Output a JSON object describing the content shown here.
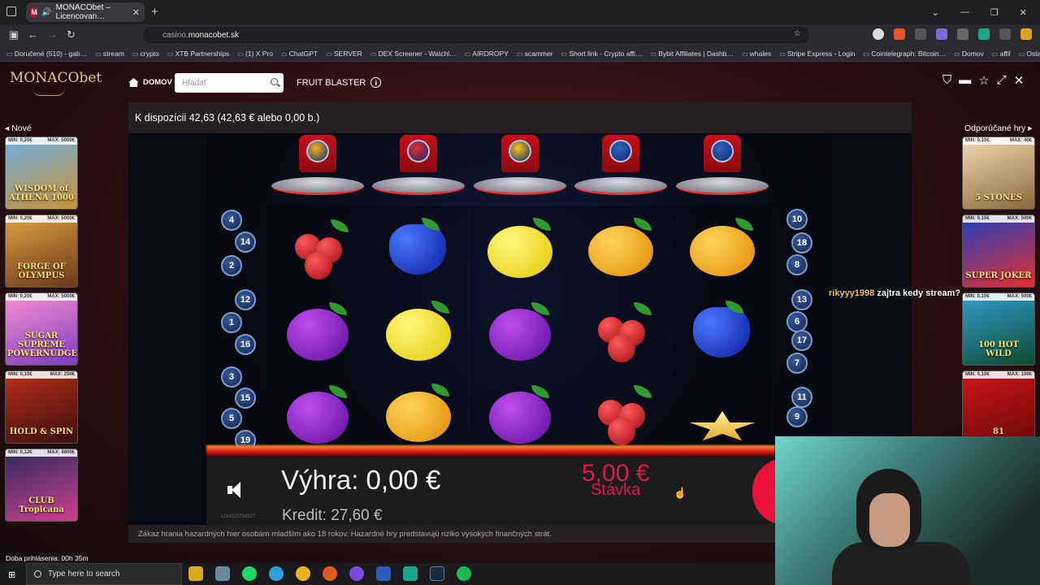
{
  "browser": {
    "tab_title": "MONACObet – Licencovan…",
    "tab_icon": "M",
    "url_prefix": "casino.",
    "url_domain": "monacobet.sk",
    "bookmarks": [
      "Doručené (510) - gab…",
      "stream",
      "crypto",
      "XTB Partnerships",
      "(1) X Pro",
      "ChatGPT",
      "SERVER",
      "DEX Screener - Watchl…",
      "AIRDROPY",
      "scammer",
      "Short link - Crypto affi…",
      "Bybit Affiliates | Dashb…",
      "whales",
      "Stripe Express - Login",
      "Cointelegraph: Bitcoin…",
      "Domov",
      "affil",
      "Ostatné záložky"
    ]
  },
  "site": {
    "logo": "MONACObet",
    "home_label": "DOMOV",
    "search_placeholder": "Hľadať",
    "game_title": "FRUIT BLASTER",
    "balance_text": "K dispozícii 42,63 (42,63 € alebo 0,00 b.)",
    "left_label": "Nové",
    "right_label": "Odporúčané hry",
    "left_games": [
      {
        "min": "MIN: 0,20€",
        "max": "MAX: 5000€",
        "title": "WISDOM of ATHENA 1000",
        "c1": "#6fb0e0",
        "c2": "#c7923a"
      },
      {
        "min": "MIN: 0,20€",
        "max": "MAX: 5000€",
        "title": "FORGE OF OLYMPUS",
        "c1": "#e0a040",
        "c2": "#6a3a18"
      },
      {
        "min": "MIN: 0,20€",
        "max": "MAX: 5000€",
        "title": "SUGAR SUPREME POWERNUDGE",
        "c1": "#ff8fd0",
        "c2": "#7a3cc0"
      },
      {
        "min": "MIN: 0,10€",
        "max": "MAX: 250€",
        "title": "HOLD & SPIN",
        "c1": "#c0301a",
        "c2": "#3a0e0e"
      },
      {
        "min": "MIN: 0,12€",
        "max": "MAX: 4800€",
        "title": "CLUB Tropicana",
        "c1": "#2a2a5a",
        "c2": "#d04090"
      }
    ],
    "right_games": [
      {
        "min": "MIN: 0,10€",
        "max": "MAX: 40€",
        "title": "5 STONES",
        "c1": "#f0dcb0",
        "c2": "#8a6a3a"
      },
      {
        "min": "MIN: 0,10€",
        "max": "MAX: 500€",
        "title": "SUPER JOKER",
        "c1": "#2040c0",
        "c2": "#e03030"
      },
      {
        "min": "MIN: 0,10€",
        "max": "MAX: 500€",
        "title": "100 HOT WILD",
        "c1": "#30a0d0",
        "c2": "#104a30"
      },
      {
        "min": "MIN: 0,10€",
        "max": "MAX: 100€",
        "title": "81",
        "c1": "#d01818",
        "c2": "#6a0808"
      }
    ],
    "disclaimer": "Zákaz hrania hazardných hier osobám mladším ako 18 rokov. Hazardné hry predstavujú riziko vysokých finančných strát.",
    "login_time": "Doba prihlásenia:   00h 35m"
  },
  "game": {
    "win_label": "Výhra:",
    "win_value": "0,00 €",
    "kredit_label": "Kredit:",
    "kredit_value": "27,60 €",
    "stake_value": "5,00 €",
    "stake_label": "Stávka",
    "serial": "1114223718527",
    "left_lines": [
      "4",
      "14",
      "2",
      "12",
      "1",
      "16",
      "3",
      "15",
      "5",
      "19"
    ],
    "right_lines": [
      "10",
      "18",
      "8",
      "13",
      "6",
      "17",
      "7",
      "11",
      "9"
    ],
    "tube_colors": [
      "#f2b21c",
      "#e03030",
      "#f3c51a",
      "#3064c0",
      "#3064c0"
    ],
    "reels": [
      [
        "cherry",
        "plum",
        "plum"
      ],
      [
        "grape",
        "lemon",
        "orange"
      ],
      [
        "lemon",
        "plum",
        "plum"
      ],
      [
        "orange",
        "cherry",
        "cherry"
      ],
      [
        "orange",
        "grape",
        "star"
      ]
    ]
  },
  "stream": {
    "chat_user": "rikyyy1998",
    "chat_message": " zajtra kedy stream?"
  },
  "taskbar": {
    "search_placeholder": "Type here to search"
  }
}
